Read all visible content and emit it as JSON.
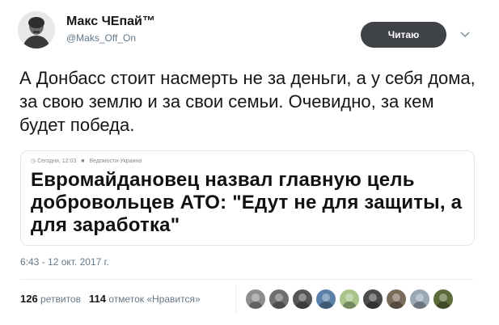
{
  "user": {
    "name": "Макс ЧЕпай™",
    "handle": "@Maks_Off_On",
    "follow_label": "Читаю"
  },
  "icons": {
    "avatar": "avatar-portrait",
    "menu": "chevron-down-icon"
  },
  "tweet": {
    "text": "А Донбасс стоит насмерть не за деньги, а у себя дома, за свою землю и за свои семьи. Очевидно, за кем будет победа."
  },
  "card": {
    "date": "Сегодня, 12:03",
    "source": "Ведомости-Украина",
    "headline": "Евромайдановец назвал главную цель добровольцев АТО: \"Едут не для защиты, а для заработка\""
  },
  "meta": {
    "timestamp": "6:43 - 12 окт. 2017 г."
  },
  "stats": {
    "retweets_count": "126",
    "retweets_label": "ретвитов",
    "likes_count": "114",
    "likes_label": "отметок «Нравится»"
  },
  "colors": {
    "follow_bg": "#3f4247",
    "secondary_text": "#657786",
    "primary_text": "#14171a",
    "border": "#e1e8ed"
  },
  "likers": [
    "#8f8f8f",
    "#6e6e6e",
    "#555555",
    "#5a7fa8",
    "#a8c48a",
    "#4a4a4a",
    "#7a6a5a",
    "#9aa7b4",
    "#5d6b3a"
  ]
}
